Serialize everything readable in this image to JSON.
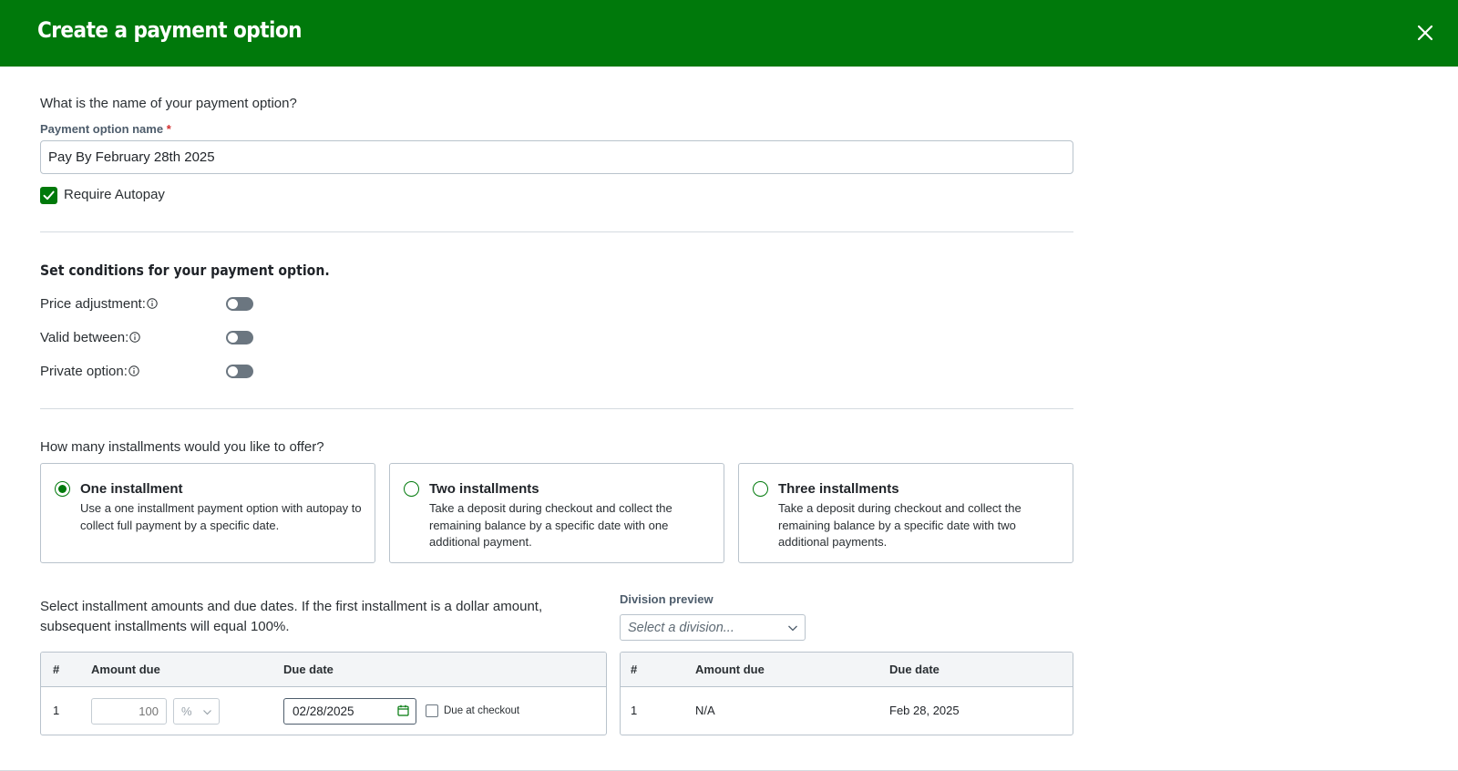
{
  "header": {
    "title": "Create a payment option",
    "close_icon": "close-icon"
  },
  "name_section": {
    "question": "What is the name of your payment option?",
    "field_label": "Payment option name",
    "required_marker": "*",
    "value": "Pay By February 28th 2025",
    "autopay_label": "Require Autopay",
    "autopay_checked": true
  },
  "conditions": {
    "heading": "Set conditions for your payment option.",
    "items": [
      {
        "label": "Price adjustment:",
        "enabled": false
      },
      {
        "label": "Valid between:",
        "enabled": false
      },
      {
        "label": "Private option:",
        "enabled": false
      }
    ]
  },
  "installments": {
    "question": "How many installments would you like to offer?",
    "options": [
      {
        "title": "One installment",
        "description": "Use a one installment payment option with autopay to collect full payment by a specific date.",
        "selected": true
      },
      {
        "title": "Two installments",
        "description": "Take a deposit during checkout and collect the remaining balance by a specific date with one additional payment.",
        "selected": false
      },
      {
        "title": "Three installments",
        "description": "Take a deposit during checkout and collect the remaining balance by a specific date with two additional payments.",
        "selected": false
      }
    ]
  },
  "schedule": {
    "description": "Select installment amounts and due dates. If the first installment is a dollar amount, subsequent installments will equal 100%.",
    "columns": [
      "#",
      "Amount due",
      "Due date"
    ],
    "rows": [
      {
        "num": "1",
        "amount": "100",
        "unit": "%",
        "due_date": "02/28/2025",
        "due_at_checkout_label": "Due at checkout",
        "due_at_checkout": false
      }
    ]
  },
  "preview": {
    "label": "Division preview",
    "select_placeholder": "Select a division...",
    "columns": [
      "#",
      "Amount due",
      "Due date"
    ],
    "rows": [
      {
        "num": "1",
        "amount": "N/A",
        "due_date": "Feb 28, 2025"
      }
    ]
  },
  "colors": {
    "brand_green": "#00790b",
    "toggle_off": "#6b7680",
    "border": "#b9c3cc",
    "label_gray": "#4e5d6c"
  }
}
